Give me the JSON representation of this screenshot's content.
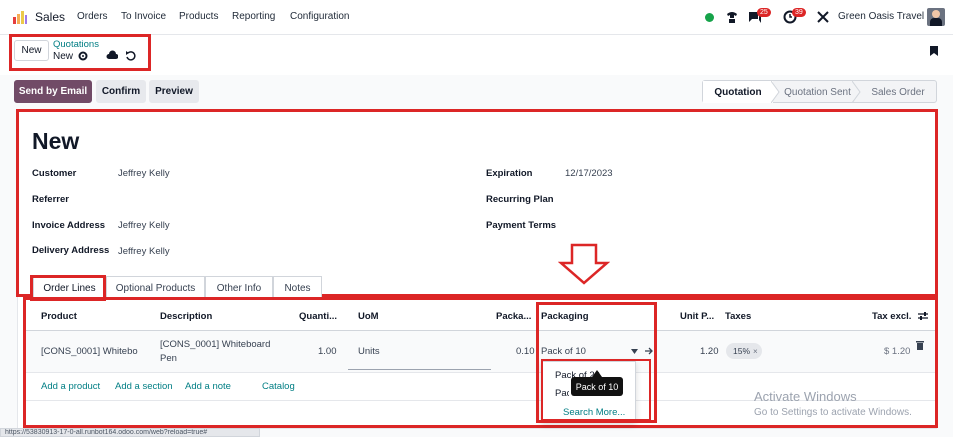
{
  "navbar": {
    "app_name": "Sales",
    "menu": [
      "Orders",
      "To Invoice",
      "Products",
      "Reporting",
      "Configuration"
    ],
    "messages_count": "25",
    "activities_count": "39",
    "company": "Green Oasis Travel"
  },
  "control_panel": {
    "new_button": "New",
    "breadcrumb_parent": "Quotations",
    "breadcrumb_current": "New"
  },
  "actions": {
    "send_email": "Send by Email",
    "confirm": "Confirm",
    "preview": "Preview"
  },
  "statusbar": [
    "Quotation",
    "Quotation Sent",
    "Sales Order"
  ],
  "form": {
    "title": "New",
    "left_fields": [
      {
        "label": "Customer",
        "value": "Jeffrey Kelly"
      },
      {
        "label": "Referrer",
        "value": ""
      },
      {
        "label": "Invoice Address",
        "value": "Jeffrey Kelly"
      },
      {
        "label": "Delivery Address",
        "value": "Jeffrey Kelly"
      }
    ],
    "right_fields": [
      {
        "label": "Expiration",
        "value": "12/17/2023"
      },
      {
        "label": "Recurring Plan",
        "value": ""
      },
      {
        "label": "Payment Terms",
        "value": ""
      }
    ]
  },
  "tabs": [
    "Order Lines",
    "Optional Products",
    "Other Info",
    "Notes"
  ],
  "table": {
    "headers": [
      "Product",
      "Description",
      "Quanti...",
      "UoM",
      "Packa...",
      "Packaging",
      "Unit P...",
      "Taxes",
      "Tax excl."
    ],
    "row": {
      "product": "[CONS_0001] Whitebo",
      "description_line1": "[CONS_0001] Whiteboard",
      "description_line2": "Pen",
      "quantity": "1.00",
      "uom": "Units",
      "packaging_qty": "0.10",
      "packaging": "Pack of 10",
      "unit_price": "1.20",
      "tax": "15%",
      "subtotal": "$ 1.20"
    },
    "add_links": [
      "Add a product",
      "Add a section",
      "Add a note",
      "Catalog"
    ]
  },
  "dropdown": {
    "options": [
      "Pack of 20",
      "Pack of 10"
    ],
    "search_more": "Search More..."
  },
  "tooltip": "Pack of 10",
  "watermark": {
    "title": "Activate Windows",
    "subtitle": "Go to Settings to activate Windows."
  },
  "browser_status": "https://53830913-17-0-all.runbot164.odoo.com/web?reload=true#"
}
